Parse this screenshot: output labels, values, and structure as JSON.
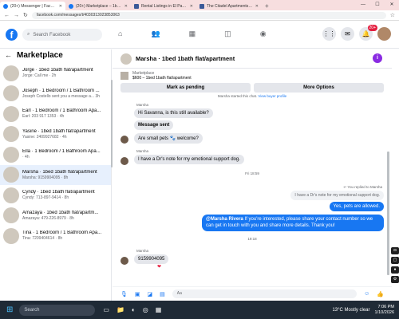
{
  "browser": {
    "tabs": [
      {
        "label": "(20+) Messenger | Facebook",
        "active": true
      },
      {
        "label": "(20+) Marketplace – 1bed 1bat",
        "active": false
      },
      {
        "label": "Rental Listings in El Paso TX - 9",
        "active": false
      },
      {
        "label": "The Citadel Apartments - 9451",
        "active": false
      }
    ],
    "url": "facebook.com/messages/t/4030313023853063"
  },
  "header": {
    "logo": "f",
    "search_placeholder": "Search Facebook",
    "notif_badge": "20+"
  },
  "sidebar": {
    "title": "Marketplace",
    "conversations": [
      {
        "name": "Jorge · 1bed 1bath flat/apartment",
        "preview": "Jorge: Call me · 2h"
      },
      {
        "name": "Joseph · 1 Bedroom / 1 Bathroom ...",
        "preview": "Joseph Costello sent you a message a... 3h"
      },
      {
        "name": "Earl · 1 Bedroom / 1 Bathroom Apa...",
        "preview": "Earl: 203 917 1353 · 4h"
      },
      {
        "name": "Yasine · 1bed 1bath flat/apartment",
        "preview": "Yasine: 2409927682 · 4h"
      },
      {
        "name": "Ella · 1 Bedroom / 1 Bathroom Apa...",
        "preview": "· 4h"
      },
      {
        "name": "Marsha · 1bed 1bath flat/apartment",
        "preview": "Marsha: 9159904095 · 8h"
      },
      {
        "name": "Cyndy · 1bed 1bath flat/apartment",
        "preview": "Cyndy: 713-897-9414 · 8h"
      },
      {
        "name": "Amazaya · 1bed 1bath flat/apartm...",
        "preview": "Amazaya: 479-226-8979 · 8h"
      },
      {
        "name": "Tina · 1 Bedroom / 1 Bathroom Apa...",
        "preview": "Tina: 7209404614 · 8h"
      }
    ],
    "selected_index": 5
  },
  "chat": {
    "title": "Marsha · 1bed 1bath flat/apartment",
    "listing_source": "Marketplace",
    "listing_title": "$600 – 1bed 1bath flat/apartment",
    "mark_pending": "Mark as pending",
    "more_options": "More Options",
    "started_note": "Marsha started this chat.",
    "buyer_profile_link": "View buyer profile",
    "messages": {
      "sender1": "Marsha",
      "m1": "Hi Savanna, is this still available?",
      "m2": "Message sent",
      "m3": "Are small pets 🐾 welcome?",
      "sender2": "Marsha",
      "m4": "I have a Dr's note for my emotional support dog.",
      "time1": "Fri 18:59",
      "replied_note": "You replied to Marsha",
      "replied_quote": "I have a Dr's note for my emotional support dog.",
      "reply1": "Yes, pets are allowed.",
      "reply2_mention": "@Marsha Rivera",
      "reply2_text": " If you're interested, please share your contact number so we can get in touch with you and share more details. Thank you!",
      "time2": "19:18",
      "sender3": "Marsha",
      "m5": "9159904095",
      "reaction": "❤"
    },
    "composer_placeholder": "Aa"
  },
  "taskbar": {
    "search": "Search",
    "weather": "13°C  Mostly clear",
    "time": "7:06 PM",
    "date": "1/10/2026"
  }
}
